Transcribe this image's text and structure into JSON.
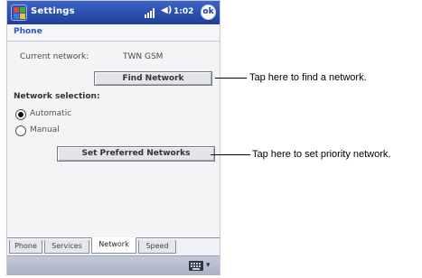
{
  "titlebar": {
    "title": "Settings",
    "time": "1:02",
    "ok_label": "ok",
    "icons": [
      "windows-logo-icon",
      "signal-icon",
      "volume-icon"
    ]
  },
  "page": {
    "title": "Phone"
  },
  "network": {
    "current_label": "Current network:",
    "current_value": "TWN GSM",
    "find_button": "Find Network",
    "selection_label": "Network selection:",
    "option_automatic": "Automatic",
    "option_manual": "Manual",
    "selected": "Automatic",
    "preferred_button": "Set Preferred Networks"
  },
  "tabs": [
    {
      "label": "Phone",
      "active": false
    },
    {
      "label": "Services",
      "active": false
    },
    {
      "label": "Network",
      "active": true
    },
    {
      "label": "Speed",
      "active": false
    }
  ],
  "bottombar": {
    "input_icon": "keyboard-icon"
  },
  "callouts": {
    "find": "Tap here to find a network.",
    "preferred": "Tap here to set priority network."
  }
}
